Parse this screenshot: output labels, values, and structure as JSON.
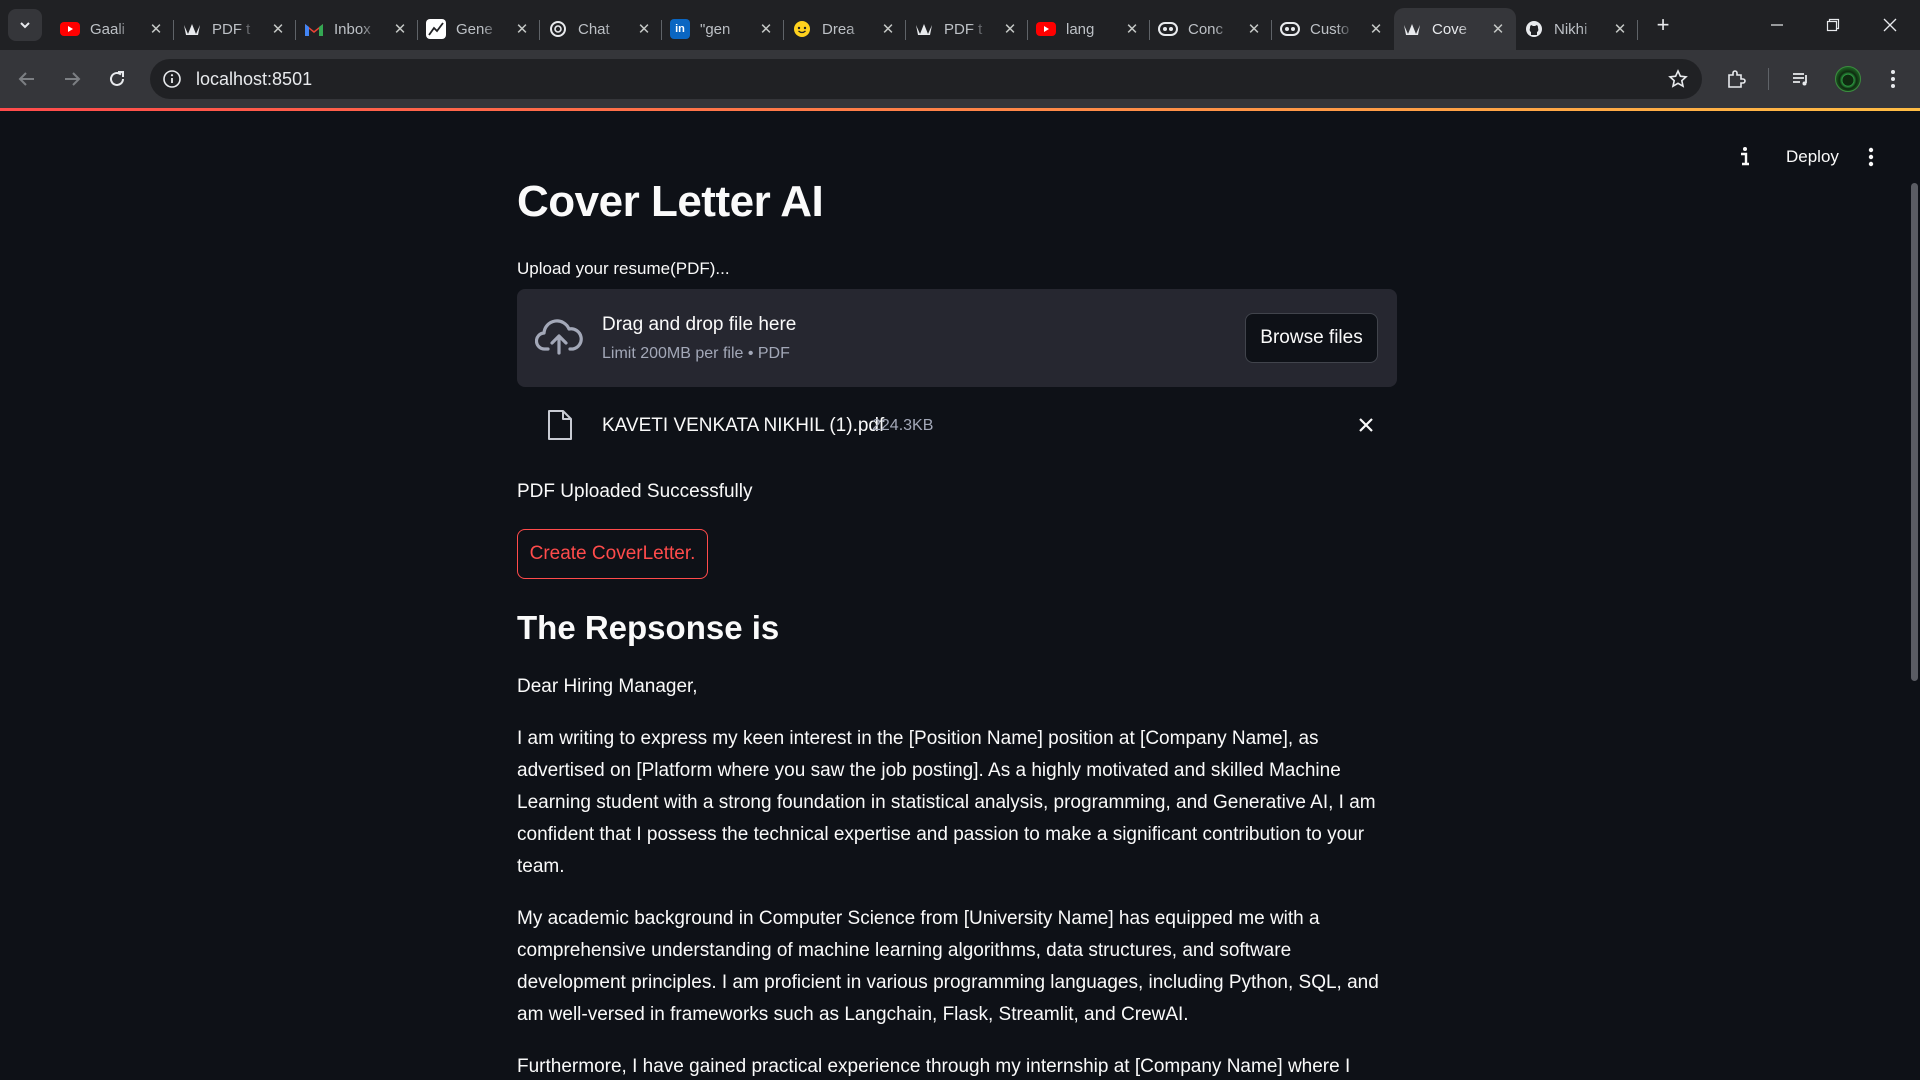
{
  "browser": {
    "tabs": [
      {
        "title": "Gaali",
        "favicon": "youtube-icon"
      },
      {
        "title": "PDF t",
        "favicon": "streamlit-crown-icon"
      },
      {
        "title": "Inbox",
        "favicon": "gmail-icon"
      },
      {
        "title": "Gene",
        "favicon": "chart-icon"
      },
      {
        "title": "Chat",
        "favicon": "openai-icon"
      },
      {
        "title": "\"gen",
        "favicon": "linkedin-icon"
      },
      {
        "title": "Drea",
        "favicon": "hugging-face-icon"
      },
      {
        "title": "PDF t",
        "favicon": "streamlit-crown-icon"
      },
      {
        "title": "lang",
        "favicon": "youtube-icon"
      },
      {
        "title": "Conc",
        "favicon": "crewai-icon"
      },
      {
        "title": "Custo",
        "favicon": "crewai-icon"
      },
      {
        "title": "Cove",
        "favicon": "streamlit-crown-icon",
        "active": true
      },
      {
        "title": "Nikhi",
        "favicon": "github-icon"
      }
    ],
    "url": "localhost:8501"
  },
  "header": {
    "deploy_label": "Deploy"
  },
  "main": {
    "title": "Cover Letter AI",
    "uploader": {
      "label": "Upload your resume(PDF)...",
      "drop_text": "Drag and drop file here",
      "limit_text": "Limit 200MB per file • PDF",
      "browse_label": "Browse files"
    },
    "uploaded_file": {
      "name": "KAVETI VENKATA NIKHIL (1).pdf",
      "size": "224.3KB"
    },
    "success_text": "PDF Uploaded Successfully",
    "create_button_label": "Create CoverLetter.",
    "response_heading": "The Repsonse is",
    "letter": {
      "greeting": "Dear Hiring Manager,",
      "p1": "I am writing to express my keen interest in the [Position Name] position at [Company Name], as advertised on [Platform where you saw the job posting]. As a highly motivated and skilled Machine Learning student with a strong foundation in statistical analysis, programming, and Generative AI, I am confident that I possess the technical expertise and passion to make a significant contribution to your team.",
      "p2": "My academic background in Computer Science from [University Name] has equipped me with a comprehensive understanding of machine learning algorithms, data structures, and software development principles. I am proficient in various programming languages, including Python, SQL, and am well-versed in frameworks such as Langchain, Flask, Streamlit, and CrewAI.",
      "p3": "Furthermore, I have gained practical experience through my internship at [Company Name] where I"
    }
  },
  "colors": {
    "app_background": "#0e1117",
    "dropzone_background": "#262730",
    "primary": "#ff4b4b",
    "muted_text": "#a3a8b8"
  }
}
